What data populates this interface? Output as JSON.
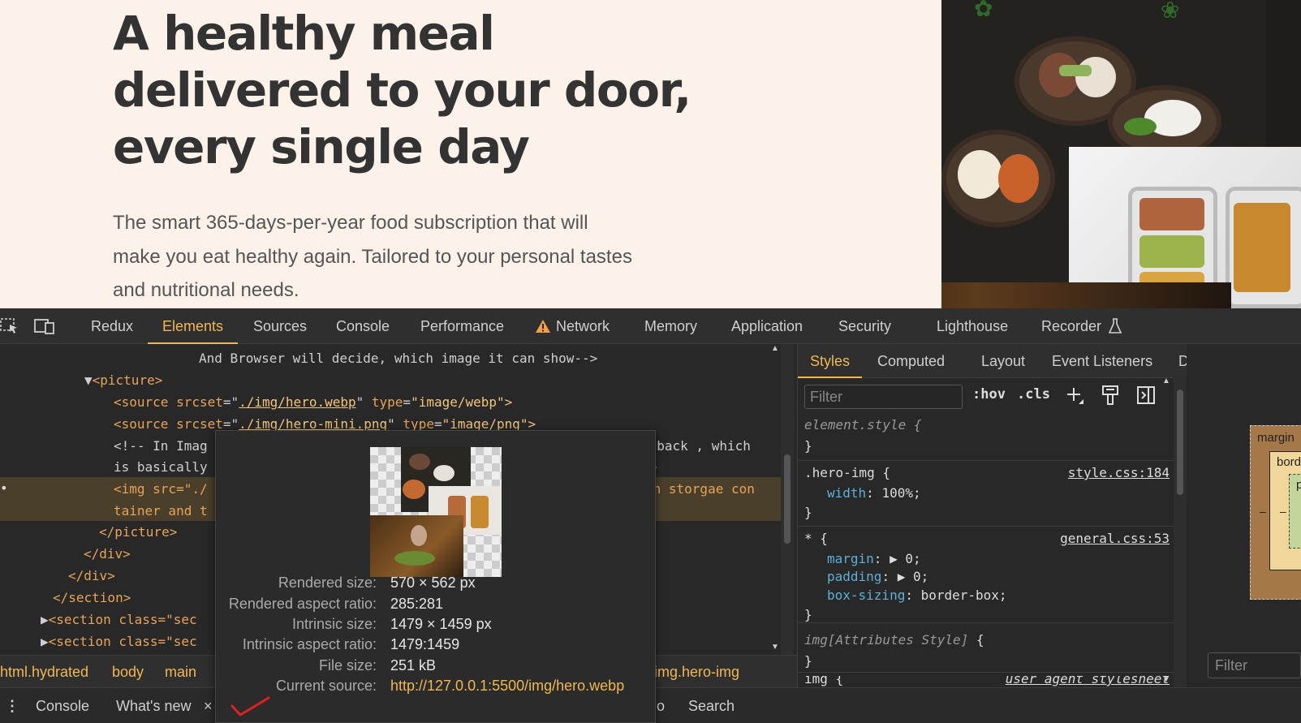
{
  "hero": {
    "title_lines": [
      "A healthy meal",
      "delivered to your door,",
      "every single day"
    ],
    "description_lines": [
      "The smart 365-days-per-year food subscription that will",
      "make you eat healthy again. Tailored to your personal tastes",
      "and nutritional needs."
    ]
  },
  "devtools": {
    "tabs": [
      "Redux",
      "Elements",
      "Sources",
      "Console",
      "Performance",
      "Network",
      "Memory",
      "Application",
      "Security",
      "Lighthouse",
      "Recorder"
    ],
    "active_tab": "Elements",
    "dom_lines": {
      "l1": "And Browser will decide, which image it can show-->",
      "l2_tag": "<picture>",
      "l3_a": "<source ",
      "l3_attr": "srcset",
      "l3_val": "./img/hero.webp",
      "l3_attr2": "type",
      "l3_val2": "\"image/webp\">",
      "l4_a": "<source ",
      "l4_attr": "srcset",
      "l4_val": "./img/hero-mini.png",
      "l4_attr2": "type",
      "l4_val2": "\"image/png\">",
      "l5_a": "<!-- In Imag",
      "l5_b": "llback , which",
      "l6_a": "is basically",
      "l6_b": "->",
      "l7_a": "<img src=\"./",
      "l7_b": "in storgae con",
      "l8_a": "tainer and t",
      "l9": "</picture>",
      "l10": "</div>",
      "l11": "</div>",
      "l12": "</section>",
      "l13": "<section class=\"sec",
      "l14": "<section class=\"sec"
    },
    "breadcrumbs": [
      "html.hydrated",
      "body",
      "main",
      "img.hero-img"
    ],
    "drawer": {
      "console": "Console",
      "whats_new": "What's new",
      "close": "×",
      "io": "o",
      "search": "Search"
    },
    "styles": {
      "tabs": [
        "Styles",
        "Computed",
        "Layout",
        "Event Listeners",
        "DOM Breakpoints"
      ],
      "active_tab": "Styles",
      "filter_placeholder": "Filter",
      "hov": ":hov",
      "cls": ".cls",
      "element_style": "element.style {",
      "close_brace": "}",
      "rule1_selector": ".hero-img {",
      "rule1_src": "style.css:184",
      "rule1_prop": "width",
      "rule1_val": " 100%;",
      "rule2_selector": "* {",
      "rule2_src": "general.css:53",
      "rule2_p1": "margin",
      "rule2_v1": " ▶ 0;",
      "rule2_p2": "padding",
      "rule2_v2": " ▶ 0;",
      "rule2_p3": "box-sizing",
      "rule2_v3": " border-box;",
      "rule3_selector": "img[Attributes Style]",
      "rule3_brace": " {",
      "rule4_partial": "img {",
      "rule4_src": "user agent stylesheet"
    },
    "boxmodel": {
      "margin": "margin",
      "border": "borde",
      "padding": "pa",
      "dash": "–",
      "filter_placeholder": "Filter"
    }
  },
  "tooltip": {
    "rows": [
      {
        "key": "Rendered size:",
        "value": "570 × 562 px"
      },
      {
        "key": "Rendered aspect ratio:",
        "value": "285:281"
      },
      {
        "key": "Intrinsic size:",
        "value": "1479 × 1459 px"
      },
      {
        "key": "Intrinsic aspect ratio:",
        "value": "1479:1459"
      },
      {
        "key": "File size:",
        "value": "251 kB"
      },
      {
        "key": "Current source:",
        "value": "http://127.0.0.1:5500/img/hero.webp"
      }
    ]
  },
  "colors": {
    "page_bg": "#fdf2e9",
    "accent": "#f0b752",
    "devtools_bg": "#282828",
    "warning": "#f0a04b",
    "check_mark": "#e02020"
  }
}
